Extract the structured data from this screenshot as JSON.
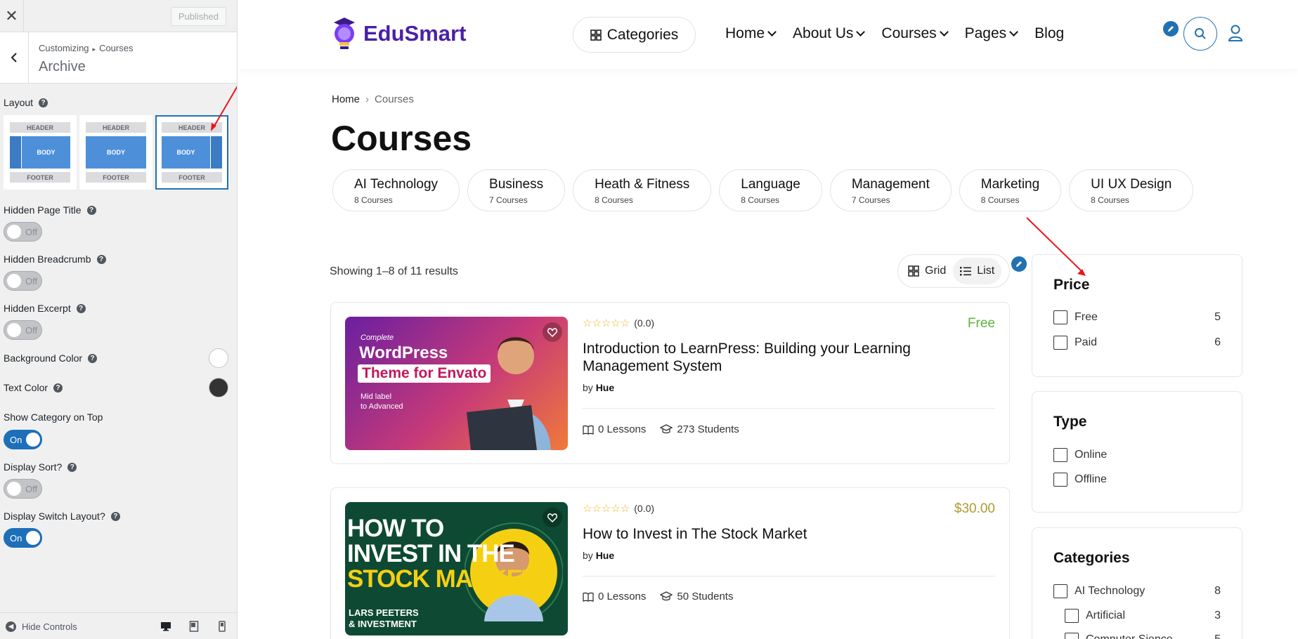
{
  "customizer": {
    "close_icon": "close-icon",
    "publish_label": "Published",
    "breadcrumb": {
      "parent": "Customizing",
      "current": "Courses"
    },
    "section_title": "Archive",
    "layout": {
      "label": "Layout",
      "options": [
        {
          "header": "HEADER",
          "body": "BODY",
          "footer": "FOOTER",
          "sidebar": "left",
          "selected": false
        },
        {
          "header": "HEADER",
          "body": "BODY",
          "footer": "FOOTER",
          "sidebar": "none",
          "selected": false
        },
        {
          "header": "HEADER",
          "body": "BODY",
          "footer": "FOOTER",
          "sidebar": "right",
          "selected": true
        }
      ]
    },
    "controls": [
      {
        "label": "Hidden Page Title",
        "type": "toggle",
        "state": "Off"
      },
      {
        "label": "Hidden Breadcrumb",
        "type": "toggle",
        "state": "Off"
      },
      {
        "label": "Hidden Excerpt",
        "type": "toggle",
        "state": "Off"
      },
      {
        "label": "Background Color",
        "type": "color",
        "value": "#ffffff"
      },
      {
        "label": "Text Color",
        "type": "color",
        "value": "#333333"
      },
      {
        "label": "Show Category on Top",
        "type": "toggle",
        "state": "On"
      },
      {
        "label": "Display Sort?",
        "type": "toggle",
        "state": "Off"
      },
      {
        "label": "Display Switch Layout?",
        "type": "toggle",
        "state": "On"
      }
    ],
    "hide_controls_label": "Hide Controls",
    "devices": [
      "desktop-icon",
      "tablet-icon",
      "mobile-icon"
    ]
  },
  "site": {
    "logo_text": "EduSmart",
    "categories_button": "Categories",
    "nav": [
      {
        "label": "Home",
        "dropdown": true
      },
      {
        "label": "About Us",
        "dropdown": true
      },
      {
        "label": "Courses",
        "dropdown": true
      },
      {
        "label": "Pages",
        "dropdown": true
      },
      {
        "label": "Blog",
        "dropdown": false
      }
    ],
    "breadcrumb": {
      "home": "Home",
      "current": "Courses"
    },
    "page_title": "Courses",
    "category_pills": [
      {
        "name": "AI Technology",
        "count": "8 Courses"
      },
      {
        "name": "Business",
        "count": "7 Courses"
      },
      {
        "name": "Heath & Fitness",
        "count": "8 Courses"
      },
      {
        "name": "Language",
        "count": "8 Courses"
      },
      {
        "name": "Management",
        "count": "7 Courses"
      },
      {
        "name": "Marketing",
        "count": "8 Courses"
      },
      {
        "name": "UI UX Design",
        "count": "8 Courses"
      }
    ],
    "results_text": "Showing 1–8 of 11 results",
    "view_switch": {
      "grid": "Grid",
      "list": "List",
      "active": "list"
    },
    "courses": [
      {
        "title": "Introduction to LearnPress: Building your Learning Management System",
        "author_prefix": "by",
        "author": "Hue",
        "rating": "(0.0)",
        "price": "Free",
        "price_color": "#5bb53b",
        "lessons": "0 Lessons",
        "students": "273 Students",
        "thumb": {
          "line1": "Complete",
          "line2": "WordPress",
          "line3": "Theme for Envato",
          "line4": "Mid label",
          "line5": "to Advanced"
        }
      },
      {
        "title": "How to Invest in The Stock Market",
        "author_prefix": "by",
        "author": "Hue",
        "rating": "(0.0)",
        "price": "$30.00",
        "price_color": "#b09a2e",
        "lessons": "0 Lessons",
        "students": "50 Students",
        "thumb": {
          "line1": "HOW TO",
          "line2": "INVEST IN THE",
          "line3": "STOCK MARKET",
          "line4": "LARS PEETERS",
          "line5": "& INVESTMENT"
        }
      }
    ],
    "sidebar": {
      "price": {
        "title": "Price",
        "options": [
          {
            "label": "Free",
            "count": "5"
          },
          {
            "label": "Paid",
            "count": "6"
          }
        ]
      },
      "type": {
        "title": "Type",
        "options": [
          {
            "label": "Online"
          },
          {
            "label": "Offline"
          }
        ]
      },
      "categories": {
        "title": "Categories",
        "options": [
          {
            "label": "AI Technology",
            "count": "8"
          },
          {
            "label": "Artificial",
            "count": "3"
          },
          {
            "label": "Computer Sience",
            "count": "5"
          }
        ]
      }
    }
  },
  "colors": {
    "accent": "#2271b1",
    "brand": "#4a1fa8",
    "annotation_arrow": "#e8161b"
  }
}
